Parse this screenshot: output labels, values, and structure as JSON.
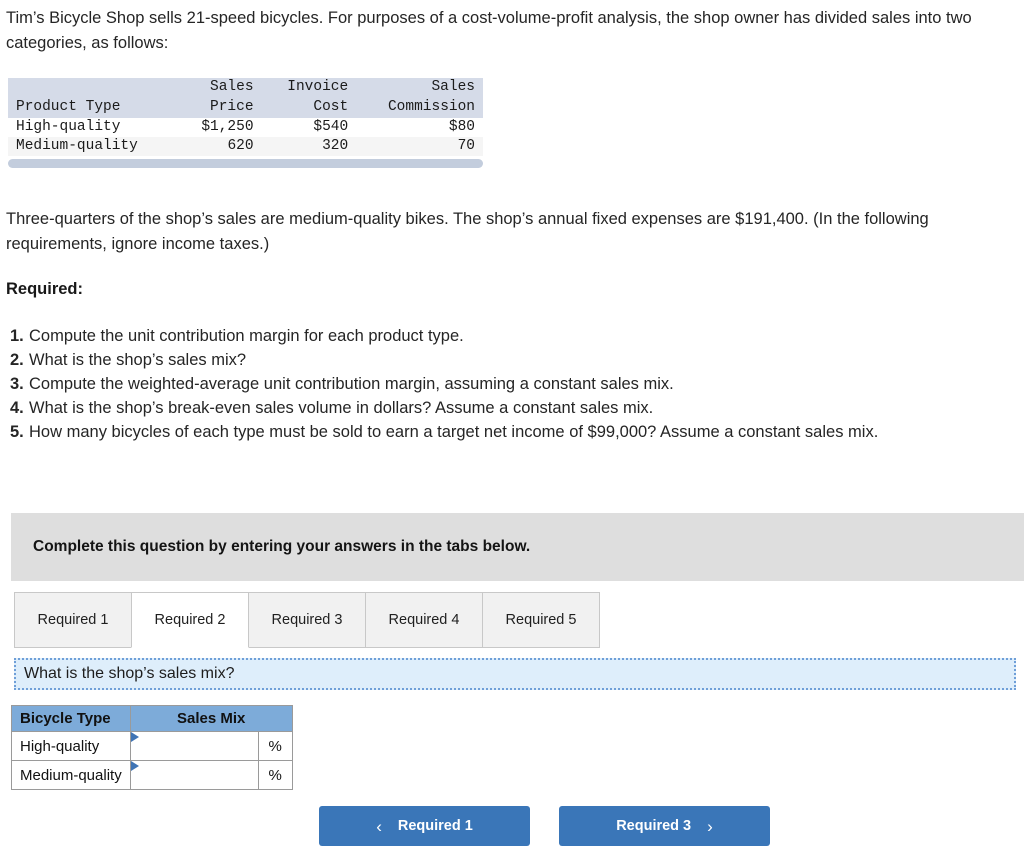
{
  "intro": {
    "paragraph1": "Tim’s Bicycle Shop sells 21-speed bicycles. For purposes of a cost-volume-profit analysis, the shop owner has divided sales into two categories, as follows:",
    "paragraph2": "Three-quarters of the shop’s sales are medium-quality bikes. The shop’s annual fixed expenses are $191,400. (In the following requirements, ignore income taxes.)",
    "required_heading": "Required:"
  },
  "data_table": {
    "headers_line1": [
      "",
      "Sales",
      "Invoice",
      "Sales"
    ],
    "headers_line2": [
      "Product Type",
      "Price",
      "Cost",
      "Commission"
    ],
    "rows": [
      {
        "product_type": "High-quality",
        "sales_price": "$1,250",
        "invoice_cost": "$540",
        "sales_commission": "$80"
      },
      {
        "product_type": "Medium-quality",
        "sales_price": "620",
        "invoice_cost": "320",
        "sales_commission": "70"
      }
    ]
  },
  "requirements": [
    {
      "num": "1.",
      "text": "Compute the unit contribution margin for each product type."
    },
    {
      "num": "2.",
      "text": "What is the shop’s sales mix?"
    },
    {
      "num": "3.",
      "text": "Compute the weighted-average unit contribution margin, assuming a constant sales mix."
    },
    {
      "num": "4.",
      "text": "What is the shop’s break-even sales volume in dollars? Assume a constant sales mix."
    },
    {
      "num": "5.",
      "text": "How many bicycles of each type must be sold to earn a target net income of $99,000? Assume a constant sales mix."
    }
  ],
  "banner": {
    "text": "Complete this question by entering your answers in the tabs below."
  },
  "tabs": [
    {
      "label": "Required 1",
      "active": false
    },
    {
      "label": "Required 2",
      "active": true
    },
    {
      "label": "Required 3",
      "active": false
    },
    {
      "label": "Required 4",
      "active": false
    },
    {
      "label": "Required 5",
      "active": false
    }
  ],
  "question_banner": {
    "text": "What is the shop’s sales mix?"
  },
  "answer_table": {
    "headers": [
      "Bicycle Type",
      "Sales Mix"
    ],
    "rows": [
      {
        "label": "High-quality",
        "value": "",
        "unit": "%"
      },
      {
        "label": "Medium-quality",
        "value": "",
        "unit": "%"
      }
    ]
  },
  "nav": {
    "prev_label": "Required 1",
    "prev_chevron": "‹",
    "next_label": "Required 3",
    "next_chevron": "›"
  },
  "colors": {
    "button_blue": "#3a76b8",
    "table_header_blue": "#7dabd9",
    "question_banner_blue": "#deeefb",
    "gray_banner": "#dedede",
    "data_header_gray": "#d5dbe8"
  }
}
